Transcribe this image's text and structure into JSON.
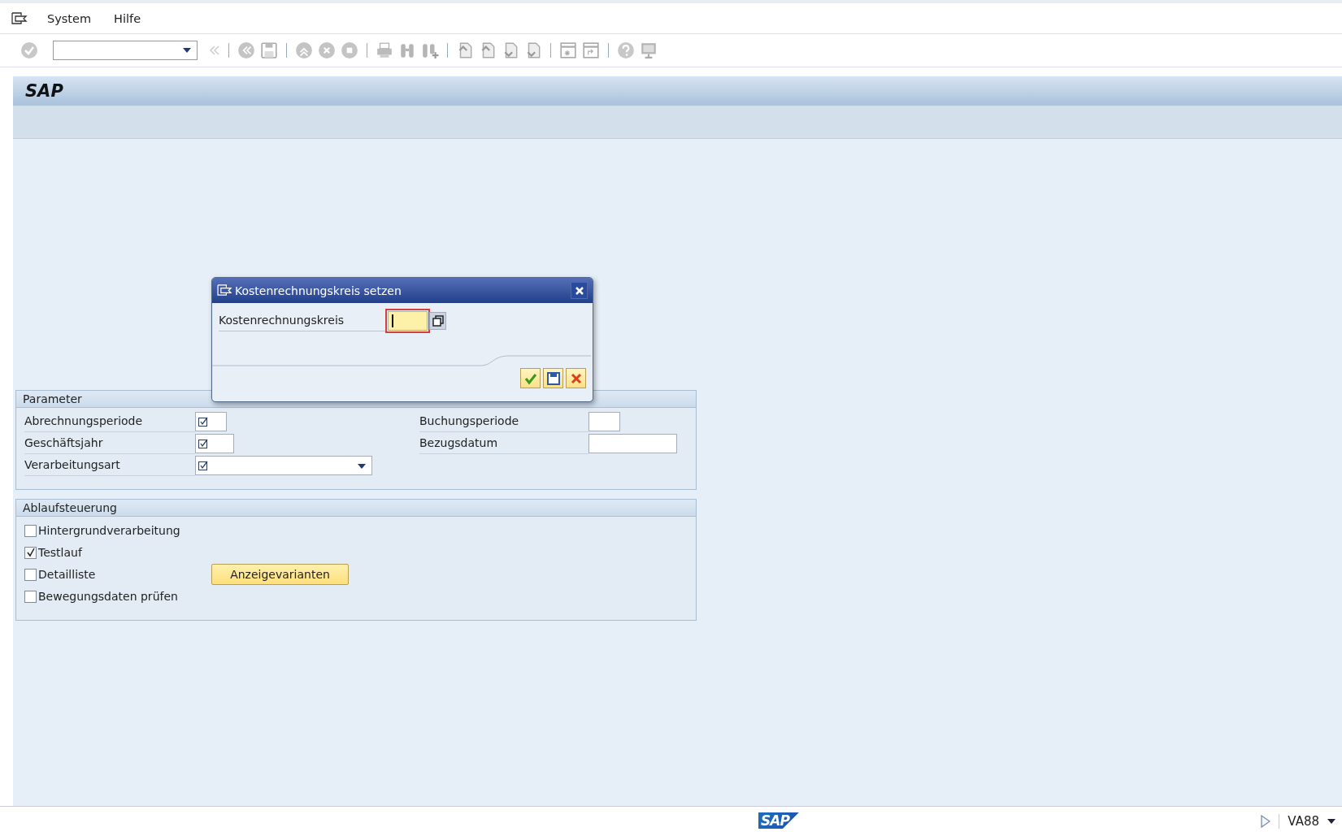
{
  "menu": [
    "System",
    "Hilfe"
  ],
  "title_bar": {
    "title": "SAP"
  },
  "dialog": {
    "title": "Kostenrechnungskreis setzen",
    "field_label": "Kostenrechnungskreis",
    "field": {
      "focused": true
    }
  },
  "parameter": {
    "title": "Parameter",
    "left": [
      {
        "label": "Abrechnungsperiode",
        "kind": "period",
        "required": true
      },
      {
        "label": "Geschäftsjahr",
        "kind": "year",
        "required": true
      },
      {
        "label": "Verarbeitungsart",
        "kind": "dropdown",
        "required": true
      }
    ],
    "right": [
      {
        "label": "Buchungsperiode",
        "kind": "period",
        "required": false
      },
      {
        "label": "Bezugsdatum",
        "kind": "date",
        "required": false
      }
    ]
  },
  "ablaufsteuerung": {
    "title": "Ablaufsteuerung",
    "items": [
      {
        "label": "Hintergrundverarbeitung",
        "checked": false
      },
      {
        "label": "Testlauf",
        "checked": true
      },
      {
        "label": "Detailliste",
        "checked": false,
        "button": "Anzeigevarianten"
      },
      {
        "label": "Bewegungsdaten prüfen",
        "checked": false
      }
    ]
  },
  "status_bar": {
    "logo": "SAP",
    "transaction": "VA88"
  }
}
